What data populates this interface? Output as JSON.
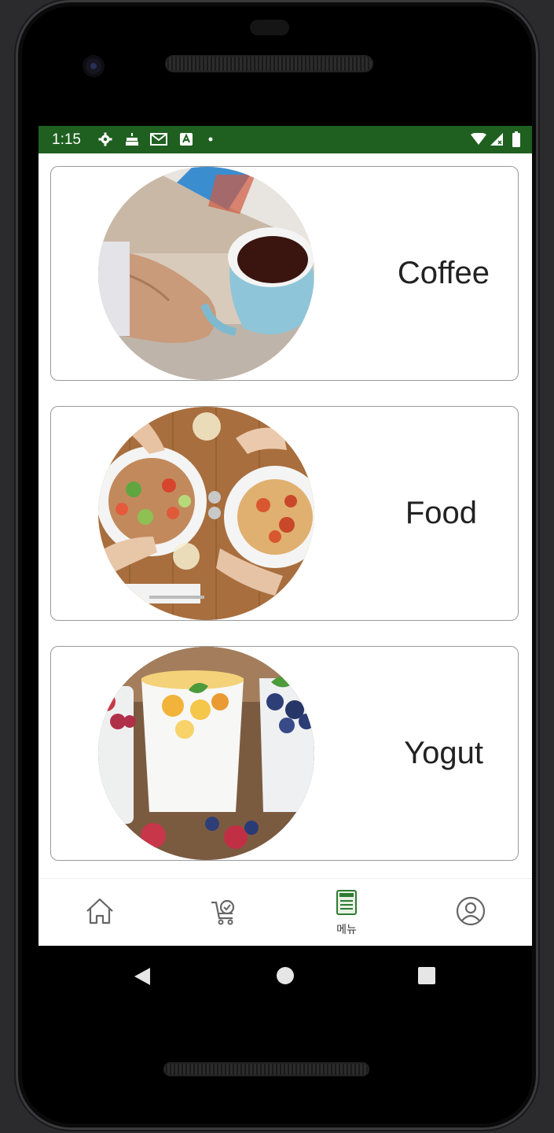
{
  "status_bar": {
    "time": "1:15",
    "left_icons": [
      "gear-icon",
      "cake-icon",
      "gmail-icon",
      "a-icon",
      "dot-icon"
    ],
    "right_icons": [
      "wifi-icon",
      "signal-icon",
      "battery-icon"
    ],
    "color": "#1f6020"
  },
  "cards": [
    {
      "label": "Coffee",
      "image": "coffee-cup-photo"
    },
    {
      "label": "Food",
      "image": "pasta-salad-table-photo"
    },
    {
      "label": "Yogut",
      "image": "yogurt-glasses-photo"
    }
  ],
  "bottom_nav": {
    "items": [
      {
        "icon": "home-icon",
        "label": ""
      },
      {
        "icon": "cart-icon",
        "label": ""
      },
      {
        "icon": "menu-icon",
        "label": "메뉴",
        "active": true
      },
      {
        "icon": "profile-icon",
        "label": ""
      }
    ],
    "active_color": "#2e7d32"
  },
  "system_nav": [
    "back-icon",
    "home-circle-icon",
    "recents-icon"
  ]
}
